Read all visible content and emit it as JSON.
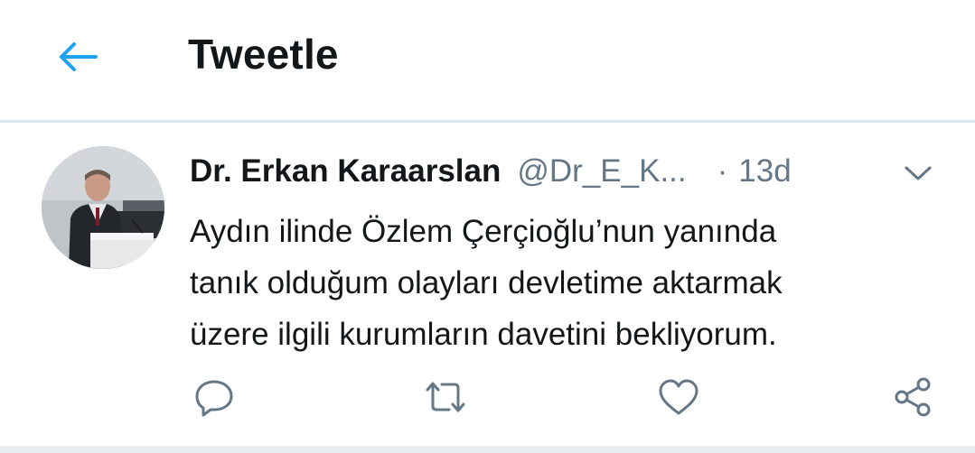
{
  "header": {
    "title": "Tweetle",
    "back_icon": "arrow-left-icon",
    "accent_color": "#1da1f2"
  },
  "tweet": {
    "author_name": "Dr. Erkan Karaarslan",
    "author_handle": "@Dr_E_K...",
    "separator": "·",
    "time": "13d",
    "text_lines": [
      "Aydın ilinde Özlem Çerçioğlu’nun yanında",
      "tanık olduğum olayları devletime aktarmak",
      "üzere ilgili kurumların davetini bekliyorum."
    ],
    "menu_icon": "chevron-down-icon",
    "actions": [
      {
        "name": "reply",
        "icon": "reply-icon"
      },
      {
        "name": "retweet",
        "icon": "retweet-icon"
      },
      {
        "name": "like",
        "icon": "heart-icon"
      },
      {
        "name": "share",
        "icon": "share-icon"
      }
    ]
  }
}
